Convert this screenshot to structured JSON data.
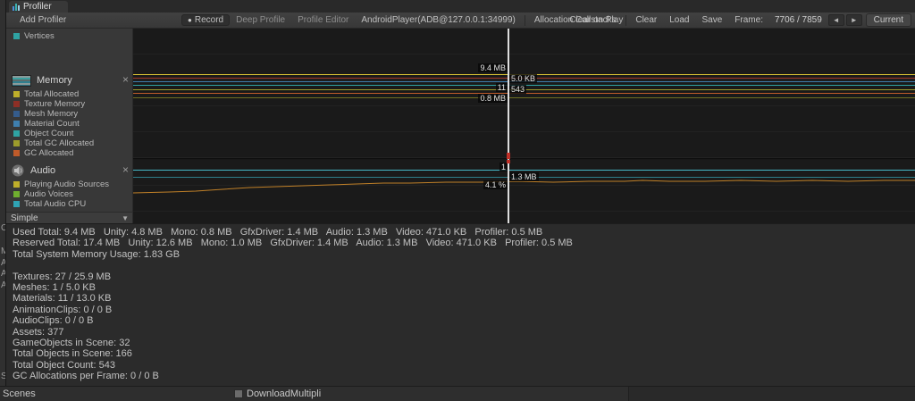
{
  "tab": {
    "title": "Profiler"
  },
  "toolbar": {
    "add_profiler": "Add Profiler",
    "record": "Record",
    "record_dot": "●",
    "deep_profile": "Deep Profile",
    "profile_editor": "Profile Editor",
    "target": "AndroidPlayer(ADB@127.0.0.1:34999)",
    "allocation_callstacks": "Allocation Callstacks",
    "clear_on_play": "Clear on Play",
    "clear": "Clear",
    "load": "Load",
    "save": "Save",
    "frame_label": "Frame:",
    "frame_value": "7706 / 7859",
    "prev": "◄",
    "next": "►",
    "current": "Current"
  },
  "sidebar": {
    "partial_item": {
      "label": "Vertices",
      "color": "#2fa3a3"
    },
    "memory": {
      "title": "Memory",
      "close": "×",
      "items": [
        {
          "label": "Total Allocated",
          "color": "#bfae2a"
        },
        {
          "label": "Texture Memory",
          "color": "#8e2f26"
        },
        {
          "label": "Mesh Memory",
          "color": "#355c8c"
        },
        {
          "label": "Material Count",
          "color": "#3f7fae"
        },
        {
          "label": "Object Count",
          "color": "#2fa3a3"
        },
        {
          "label": "Total GC Allocated",
          "color": "#9c9c2c"
        },
        {
          "label": "GC Allocated",
          "color": "#bf5b2a"
        }
      ]
    },
    "audio": {
      "title": "Audio",
      "close": "×",
      "items": [
        {
          "label": "Playing Audio Sources",
          "color": "#bfae2a"
        },
        {
          "label": "Audio Voices",
          "color": "#6fae2f"
        },
        {
          "label": "Total Audio CPU",
          "color": "#2fa3b4"
        }
      ]
    },
    "mode": "Simple",
    "mode_caret": "▼"
  },
  "charts": {
    "memory": {
      "lines": [
        {
          "y": 51,
          "color": "#d4bd33"
        },
        {
          "y": 55,
          "color": "#a33a2b"
        },
        {
          "y": 59,
          "color": "#3f7fae"
        },
        {
          "y": 63,
          "color": "#2fa3a3"
        },
        {
          "y": 68,
          "color": "#9c9c2c"
        },
        {
          "y": 72,
          "color": "#bf5b2a"
        },
        {
          "y": 77,
          "color": "#6f6f22"
        }
      ],
      "labels": [
        {
          "text": "9.4 MB",
          "side": "left",
          "y": 39
        },
        {
          "text": "5.0 KB",
          "side": "right",
          "y": 51
        },
        {
          "text": "11",
          "side": "left",
          "y": 61
        },
        {
          "text": "543",
          "side": "right",
          "y": 63
        },
        {
          "text": "0.8 MB",
          "side": "left",
          "y": 73
        }
      ]
    },
    "audio": {
      "lines": [
        {
          "y": 11,
          "color": "#46b9c8"
        },
        {
          "y": 19,
          "color": "#2e7d8a"
        }
      ],
      "labels": [
        {
          "text": "1",
          "side": "left",
          "y": 3
        },
        {
          "text": "1.3 MB",
          "side": "right",
          "y": 14
        },
        {
          "text": "4.1 %",
          "side": "left",
          "y": 23
        }
      ],
      "curve_color": "#c08028",
      "curve": [
        [
          0,
          37
        ],
        [
          40,
          36
        ],
        [
          70,
          35
        ],
        [
          100,
          33
        ],
        [
          130,
          31
        ],
        [
          160,
          30
        ],
        [
          190,
          29
        ],
        [
          220,
          28
        ],
        [
          250,
          27
        ],
        [
          280,
          26
        ],
        [
          310,
          26
        ],
        [
          350,
          25
        ],
        [
          390,
          25
        ],
        [
          430,
          24
        ],
        [
          470,
          25
        ],
        [
          510,
          24
        ],
        [
          550,
          24
        ],
        [
          570,
          23
        ],
        [
          600,
          24
        ],
        [
          640,
          24
        ],
        [
          680,
          23
        ],
        [
          720,
          24
        ],
        [
          760,
          23
        ],
        [
          800,
          24
        ],
        [
          840,
          23
        ],
        [
          876,
          23
        ]
      ]
    }
  },
  "details": {
    "lines": [
      "Used Total: 9.4 MB   Unity: 4.8 MB   Mono: 0.8 MB   GfxDriver: 1.4 MB   Audio: 1.3 MB   Video: 471.0 KB   Profiler: 0.5 MB",
      "Reserved Total: 17.4 MB   Unity: 12.6 MB   Mono: 1.0 MB   GfxDriver: 1.4 MB   Audio: 1.3 MB   Video: 471.0 KB   Profiler: 0.5 MB",
      "Total System Memory Usage: 1.83 GB",
      "",
      "Textures: 27 / 25.9 MB",
      "Meshes: 1 / 5.0 KB",
      "Materials: 11 / 13.0 KB",
      "AnimationClips: 0 / 0 B",
      "AudioClips: 0 / 0 B",
      "Assets: 377",
      "GameObjects in Scene: 32",
      "Total Objects in Scene: 166",
      "Total Object Count: 543",
      "GC Allocations per Frame: 0 / 0 B"
    ]
  },
  "underlying": {
    "scenes_label": "Scenes",
    "download_label": "DownloadMultipli",
    "edge_letters": [
      "C",
      "M",
      "A",
      "A",
      "A",
      "S"
    ]
  }
}
